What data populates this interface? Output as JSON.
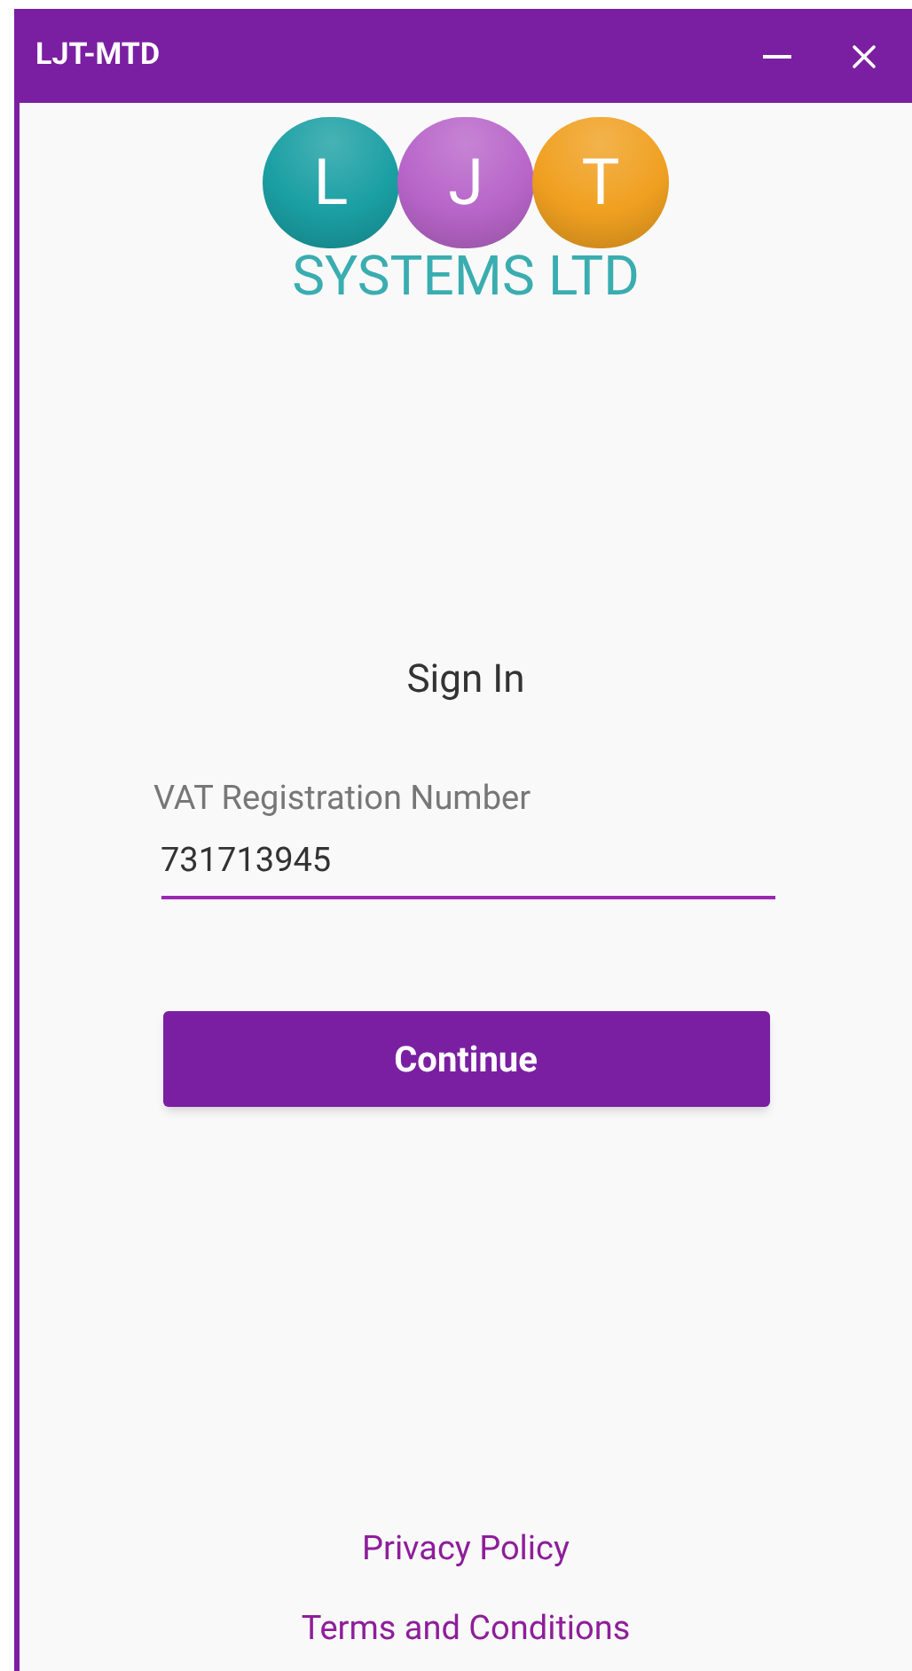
{
  "window": {
    "title": "LJT-MTD"
  },
  "logo": {
    "letters": [
      {
        "text": "L",
        "color": "#1a9fa3"
      },
      {
        "text": "J",
        "color": "#b865c9"
      },
      {
        "text": "T",
        "color": "#f0a020"
      }
    ],
    "tagline": "SYSTEMS LTD"
  },
  "heading": "Sign In",
  "field": {
    "label": "VAT Registration Number",
    "value": "731713945"
  },
  "button": "Continue",
  "links": [
    "Privacy Policy",
    "Terms and Conditions"
  ]
}
